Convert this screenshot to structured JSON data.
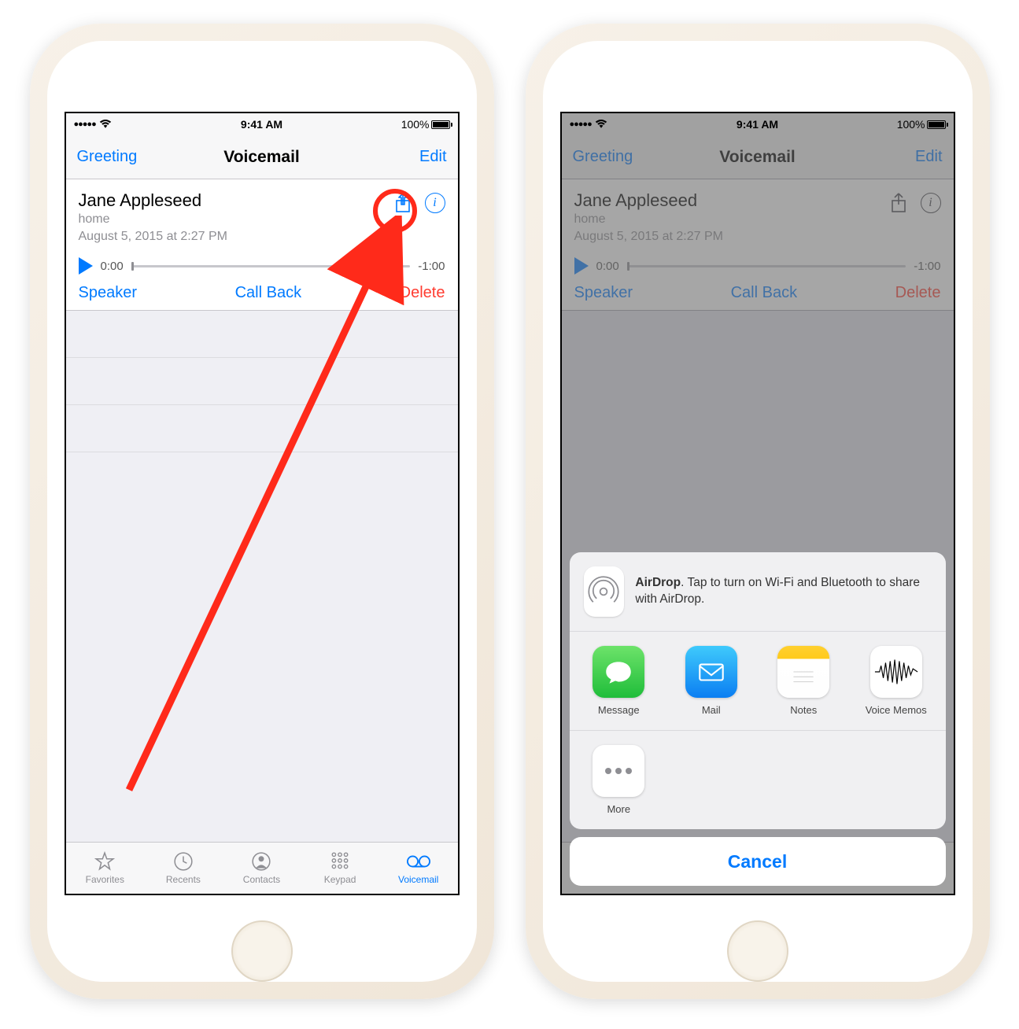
{
  "status": {
    "time": "9:41 AM",
    "battery": "100%"
  },
  "nav": {
    "left": "Greeting",
    "title": "Voicemail",
    "right": "Edit"
  },
  "voicemail": {
    "name": "Jane Appleseed",
    "label": "home",
    "date": "August 5, 2015 at 2:27 PM",
    "elapsed": "0:00",
    "remaining": "-1:00"
  },
  "actions": {
    "speaker": "Speaker",
    "callback": "Call Back",
    "delete": "Delete"
  },
  "tabs": {
    "favorites": "Favorites",
    "recents": "Recents",
    "contacts": "Contacts",
    "keypad": "Keypad",
    "voicemail": "Voicemail"
  },
  "share": {
    "airdrop_label": "AirDrop",
    "airdrop_text": ". Tap to turn on Wi-Fi and Bluetooth to share with AirDrop.",
    "apps": {
      "message": "Message",
      "mail": "Mail",
      "notes": "Notes",
      "voice_memos": "Voice Memos",
      "more": "More"
    },
    "cancel": "Cancel"
  }
}
